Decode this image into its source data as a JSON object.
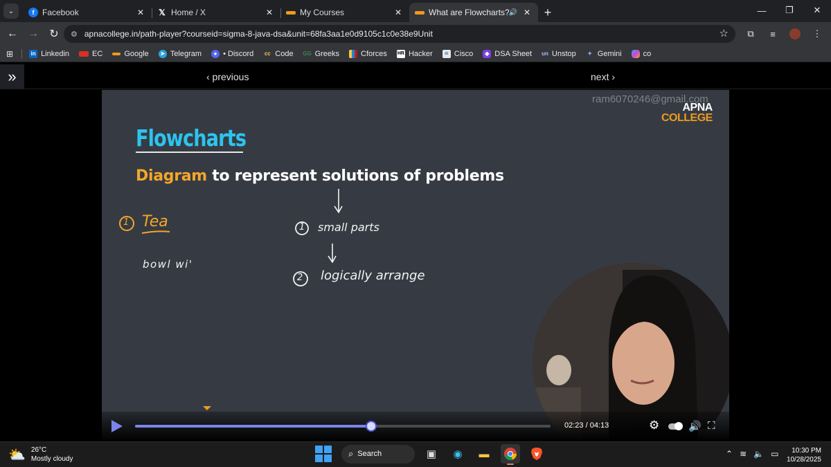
{
  "browser": {
    "tabs": [
      {
        "title": "Facebook",
        "favicon": "facebook-icon",
        "color": "#1877f2"
      },
      {
        "title": "Home / X",
        "favicon": "x-icon",
        "color": "#000000"
      },
      {
        "title": "My Courses",
        "favicon": "apna-college-icon",
        "color": "#f09a1d"
      },
      {
        "title": "What are Flowcharts?",
        "favicon": "apna-college-icon",
        "color": "#f09a1d",
        "active": true
      }
    ],
    "url": "apnacollege.in/path-player?courseid=sigma-8-java-dsa&unit=68fa3aa1e0d9105c1c0e38e9Unit",
    "bookmarks": [
      "Linkedin",
      "EC",
      "Google",
      "Telegram",
      "• Discord",
      "Code",
      "Greeks",
      "Cforces",
      "Hacker",
      "Cisco",
      "DSA Sheet",
      "Unstop",
      "Gemini",
      "co"
    ]
  },
  "site": {
    "prev_label": "‹ previous",
    "next_label": "next ›"
  },
  "slide": {
    "watermark": "ram6070246@gmail.com",
    "logo_line1": "APNA",
    "logo_line2": "COLLEGE",
    "title": "Flowcharts",
    "subtitle_highlight": "Diagram",
    "subtitle_rest": " to represent solutions of problems",
    "notes": {
      "tea_number": "1",
      "tea": "Tea",
      "bowl": "bowl wi'",
      "item1_number": "1",
      "item1": "small parts",
      "item2_number": "2",
      "item2": "logically arrange"
    }
  },
  "player": {
    "time": "02:23 / 04:13",
    "progress": 0.568
  },
  "taskbar": {
    "temp": "26°C",
    "weather": "Mostly cloudy",
    "search": "Search",
    "time": "10:30 PM",
    "date": "10/28/2025"
  }
}
